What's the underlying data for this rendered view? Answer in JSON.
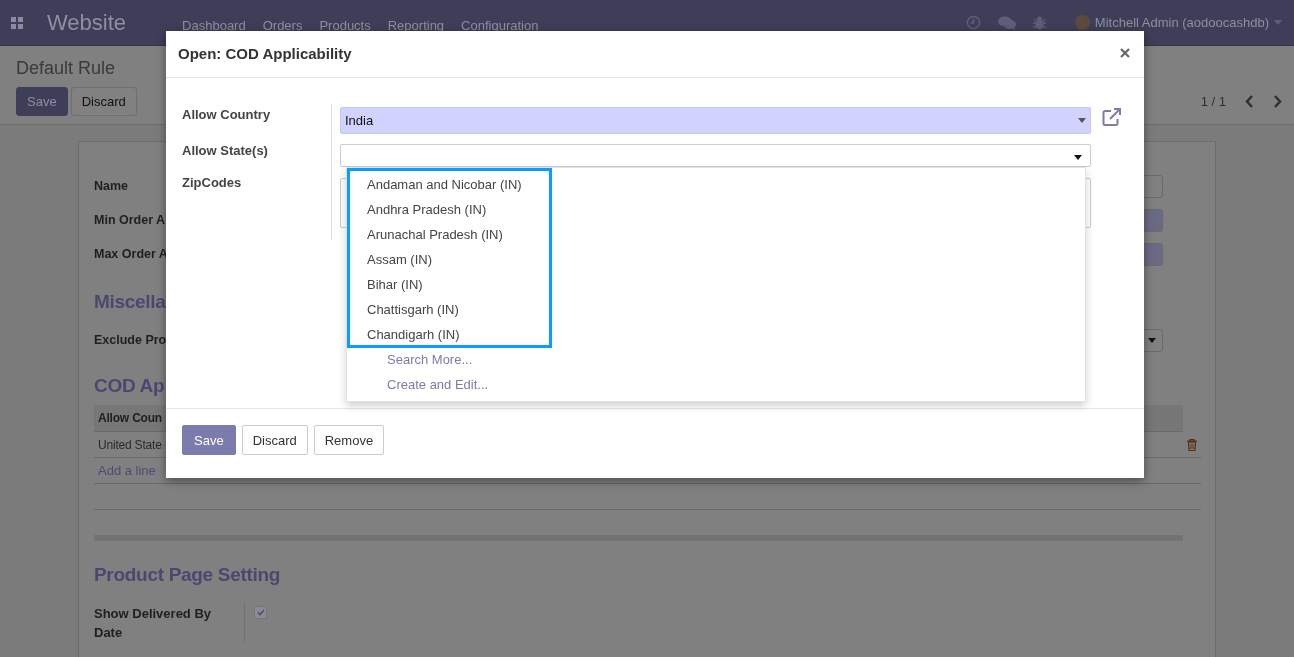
{
  "navbar": {
    "app_name": "Website",
    "menu": [
      "Dashboard",
      "Orders",
      "Products",
      "Reporting",
      "Configuration"
    ],
    "user": "Mitchell Admin (aodoocashdb)"
  },
  "control_panel": {
    "title": "Default Rule",
    "buttons": [
      {
        "label": "Save",
        "primary": true
      },
      {
        "label": "Discard",
        "primary": false
      }
    ],
    "pager": "1 / 1"
  },
  "sheet": {
    "top_fields": [
      {
        "label": "Name",
        "kind": "input"
      },
      {
        "label": "Min Order A",
        "kind": "required"
      },
      {
        "label": "Max Order A",
        "kind": "required"
      }
    ],
    "misc_heading": "Miscella",
    "misc_fields": [
      {
        "label": "Exclude Pro",
        "kind": "select"
      }
    ],
    "cod_heading": "COD Ap",
    "table": {
      "columns": [
        "Allow Coun"
      ],
      "rows": [
        [
          "United State"
        ]
      ],
      "add_line": "Add a line"
    },
    "product_heading": "Product Page Setting",
    "product_fields": [
      {
        "label": "Show Delivered By Date",
        "checked": true
      }
    ]
  },
  "modal": {
    "title": "Open: COD Applicability",
    "fields": [
      {
        "label": "Allow Country",
        "kind": "many2one",
        "value": "India",
        "required": true
      },
      {
        "label": "Allow State(s)",
        "kind": "many2many",
        "required": false
      },
      {
        "label": "ZipCodes",
        "kind": "text",
        "required": false
      }
    ],
    "dropdown": {
      "options": [
        "Andaman and Nicobar (IN)",
        "Andhra Pradesh (IN)",
        "Arunachal Pradesh (IN)",
        "Assam (IN)",
        "Bihar (IN)",
        "Chattisgarh (IN)",
        "Chandigarh (IN)"
      ],
      "actions": [
        "Search More...",
        "Create and Edit..."
      ]
    },
    "buttons": [
      {
        "label": "Save",
        "primary": true
      },
      {
        "label": "Discard",
        "primary": false
      },
      {
        "label": "Remove",
        "primary": false
      }
    ]
  }
}
